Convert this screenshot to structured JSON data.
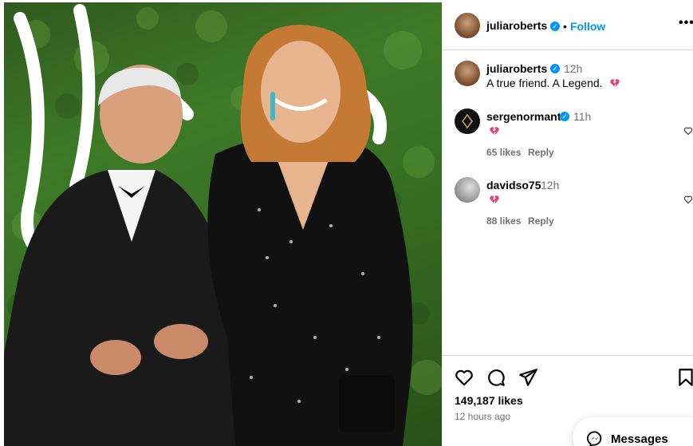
{
  "post_header": {
    "username": "juliaroberts",
    "separator": "•",
    "follow_label": "Follow",
    "more_icon": "more-options-icon"
  },
  "caption": {
    "username": "juliaroberts",
    "time": "12h",
    "text": "A true friend. A Legend.",
    "emoji_icon": "broken-heart-icon"
  },
  "comments": [
    {
      "username": "sergenormant",
      "time": "11h",
      "likes": "65 likes",
      "reply": "Reply",
      "emoji_icon": "broken-heart-icon"
    },
    {
      "username": "davidso75",
      "time": "12h",
      "likes": "88 likes",
      "reply": "Reply",
      "emoji_icon": "broken-heart-icon"
    }
  ],
  "actions": {
    "likes": "149,187 likes",
    "posted": "12 hours ago"
  },
  "messages": {
    "label": "Messages"
  },
  "colors": {
    "accent": "#0095f6",
    "broken_heart": "#e0457b",
    "muted": "#737373"
  }
}
